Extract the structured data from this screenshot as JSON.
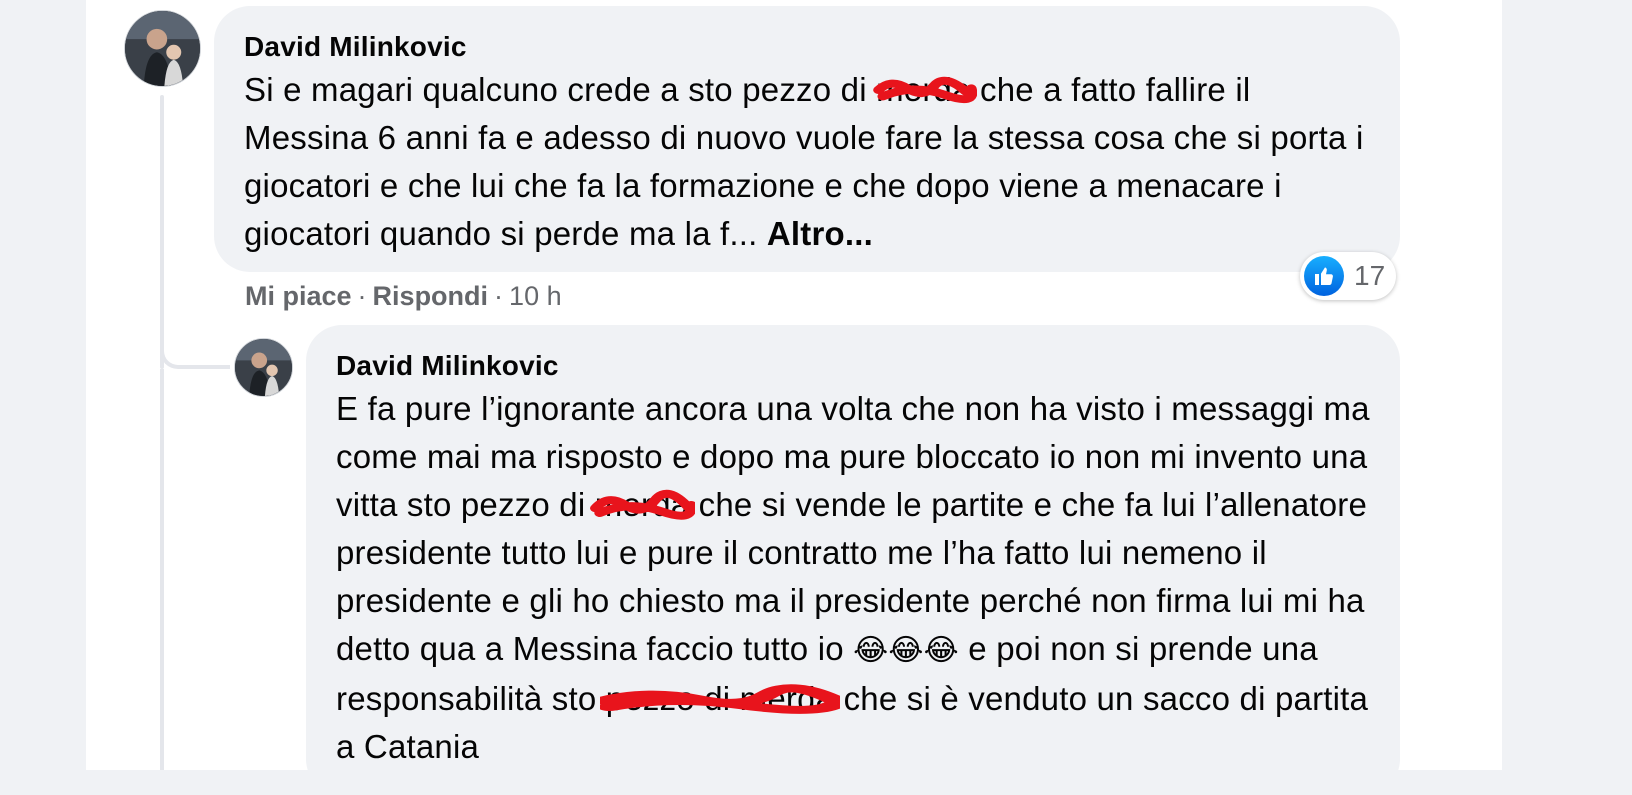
{
  "comment": {
    "author": "David Milinkovic",
    "text_a": "Si e magari qualcuno crede a sto pezzo di ",
    "redacted_1": "merda",
    "text_b": " che a fatto fallire il Messina 6 anni fa e adesso di nuovo vuole fare la stessa cosa che si porta i giocatori e che lui che fa la formazione e che dopo viene a menacare i giocatori quando si perde ma la f... ",
    "more_label": "Altro...",
    "actions": {
      "like_label": "Mi piace",
      "reply_label": "Rispondi",
      "time": "10 h",
      "separator": "·"
    },
    "reactions": {
      "icon": "like-icon",
      "count": "17"
    }
  },
  "reply": {
    "author": "David Milinkovic",
    "text_a": "E fa pure l’ignorante ancora una volta che non ha visto i messaggi ma come mai ma risposto e dopo ma pure bloccato io non mi invento una vitta sto pezzo di ",
    "redacted_1": "merda",
    "text_b": " che si vende le partite e che fa lui l’allenatore presidente tutto lui e pure il contratto me l’ha fatto lui nemeno il presidente e gli ho chiesto ma il presidente perché non firma lui mi ha detto qua a Messina faccio tutto io ",
    "emojis": "😂😂😂",
    "text_c": " e poi non si prende una responsabilità sto ",
    "redacted_2": "pezzo di merda",
    "text_d": " che si è venduto un sacco di partita a Catania"
  },
  "colors": {
    "bubble": "#f0f2f5",
    "meta_text": "#65676b",
    "like_blue": "#0866ff",
    "redaction": "#e8141c"
  }
}
